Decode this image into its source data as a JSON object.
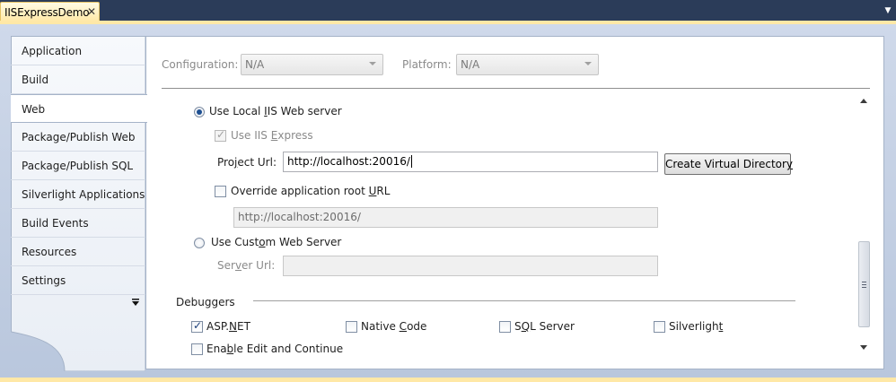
{
  "document_tab": {
    "title": "IISExpressDemo",
    "close_glyph": "✕"
  },
  "nav": {
    "items": [
      {
        "label": "Application"
      },
      {
        "label": "Build"
      },
      {
        "label": "Web",
        "active": true
      },
      {
        "label": "Package/Publish Web"
      },
      {
        "label": "Package/Publish SQL"
      },
      {
        "label": "Silverlight Applications"
      },
      {
        "label": "Build Events"
      },
      {
        "label": "Resources"
      },
      {
        "label": "Settings"
      }
    ],
    "more_icon": "chevron-down-bar-icon"
  },
  "config": {
    "configuration_label": "Configuration:",
    "configuration_value": "N/A",
    "platform_label": "Platform:",
    "platform_value": "N/A"
  },
  "servers": {
    "local_iis": {
      "label_pre": "Use Local ",
      "label_u": "I",
      "label_post": "IS Web server",
      "selected": true
    },
    "use_iis_express": {
      "label_pre": "Use IIS ",
      "label_u": "E",
      "label_post": "xpress",
      "checked": true,
      "enabled": false
    },
    "project_url": {
      "label_pre": "Pro",
      "label_u": "j",
      "label_post": "ect Url:",
      "value": "http://localhost:20016/"
    },
    "create_vdir_button": {
      "label_pre": "Create Virtual Director",
      "label_u": "y",
      "label_post": ""
    },
    "override_root": {
      "label_pre": "Override application root ",
      "label_u": "U",
      "label_post": "RL",
      "checked": false
    },
    "override_url_value": "http://localhost:20016/",
    "custom_server": {
      "label_pre": "Use Cust",
      "label_u": "o",
      "label_post": "m Web Server",
      "selected": false
    },
    "server_url": {
      "label_pre": "Ser",
      "label_u": "v",
      "label_post": "er Url:",
      "value": ""
    }
  },
  "debuggers": {
    "title": "Debuggers",
    "aspnet": {
      "label_pre": "ASP.",
      "label_u": "N",
      "label_post": "ET",
      "checked": true
    },
    "native": {
      "label_pre": "Native ",
      "label_u": "C",
      "label_post": "ode",
      "checked": false
    },
    "sql": {
      "label_pre": "S",
      "label_u": "Q",
      "label_post": "L Server",
      "checked": false
    },
    "silverlight": {
      "label_pre": "Silverligh",
      "label_u": "t",
      "label_post": "",
      "checked": false
    },
    "edit_continue": {
      "label_pre": "Ena",
      "label_u": "b",
      "label_post": "le Edit and Continue",
      "checked": false
    }
  },
  "colors": {
    "frame_dark": "#29395a",
    "tab_gold": "#ffe8a6",
    "panel_bg": "#ffffff"
  }
}
